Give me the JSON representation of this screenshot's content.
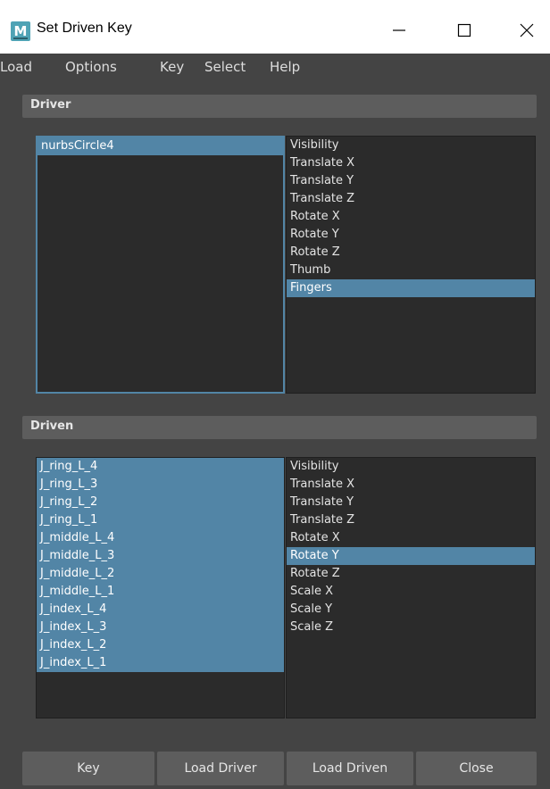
{
  "window": {
    "title": "Set Driven Key",
    "icon": "maya-icon"
  },
  "menu": [
    "Load",
    "Options",
    "Key",
    "Select",
    "Help"
  ],
  "driver": {
    "header": "Driver",
    "objects": [
      "nurbsCircle4"
    ],
    "objects_selected": [
      0
    ],
    "attributes": [
      "Visibility",
      "Translate X",
      "Translate Y",
      "Translate Z",
      "Rotate X",
      "Rotate Y",
      "Rotate Z",
      "Thumb",
      "Fingers"
    ],
    "attributes_selected": [
      8
    ]
  },
  "driven": {
    "header": "Driven",
    "objects": [
      "J_ring_L_4",
      "J_ring_L_3",
      "J_ring_L_2",
      "J_ring_L_1",
      "J_middle_L_4",
      "J_middle_L_3",
      "J_middle_L_2",
      "J_middle_L_1",
      "J_index_L_4",
      "J_index_L_3",
      "J_index_L_2",
      "J_index_L_1"
    ],
    "objects_selected": [
      0,
      1,
      2,
      3,
      4,
      5,
      6,
      7,
      8,
      9,
      10,
      11
    ],
    "attributes": [
      "Visibility",
      "Translate X",
      "Translate Y",
      "Translate Z",
      "Rotate X",
      "Rotate Y",
      "Rotate Z",
      "Scale X",
      "Scale Y",
      "Scale Z"
    ],
    "attributes_selected": [
      5
    ]
  },
  "buttons": {
    "key": "Key",
    "load_driver": "Load Driver",
    "load_driven": "Load Driven",
    "close": "Close"
  },
  "colors": {
    "selection": "#5285a6",
    "background": "#444444",
    "list_bg": "#2b2b2b"
  }
}
